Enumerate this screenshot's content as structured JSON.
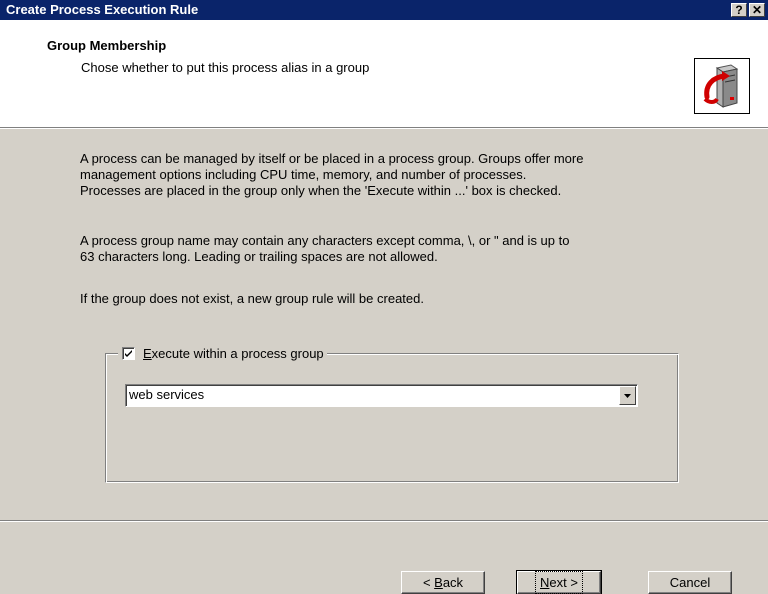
{
  "window": {
    "title": "Create Process Execution Rule",
    "help_glyph": "?",
    "close_glyph": "✕"
  },
  "header": {
    "title": "Group Membership",
    "subtitle": "Chose whether to put this process alias in a group",
    "icon": "process-server-icon"
  },
  "body": {
    "para1": "A process can be managed by itself or be placed in a process group.  Groups offer more\nmanagement options including CPU time, memory, and number of processes.\nProcesses are placed in the group only when the 'Execute within ...' box is checked.",
    "para2": "A process group name may contain any characters except comma, \\, or \" and is up to\n63 characters long.  Leading or trailing spaces are not allowed.",
    "para3": "If the group does not exist, a new group rule will be created."
  },
  "group": {
    "checkbox_checked": true,
    "checkbox_label_mnemonic": "E",
    "checkbox_label_rest": "xecute within a process group",
    "combo_value": "web services"
  },
  "buttons": {
    "back_prefix": "< ",
    "back_mnemonic": "B",
    "back_rest": "ack",
    "next_mnemonic": "N",
    "next_rest": "ext >",
    "cancel": "Cancel"
  }
}
